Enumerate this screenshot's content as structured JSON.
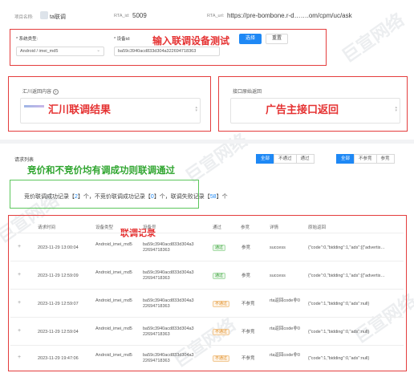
{
  "header": {
    "project_label": "项目名称:",
    "project_name": "ta联调",
    "rta_label": "RTA_id:",
    "rta_id": "5009",
    "url_label": "RTA_url:",
    "url": "https://pre-bombone.r-d…….om/cpm/uc/ask"
  },
  "config": {
    "system_type_label": "* 系统类型:",
    "system_type_value": "Android / imei_md5",
    "device_id_label": "* 设备id:",
    "device_id_value": "ba59c3940acd833d304a322694718363",
    "select_button": "选择",
    "reset_button": "重置"
  },
  "result_panel": {
    "title": "汇川返回内容",
    "help_icon": "?"
  },
  "api_panel": {
    "title": "接口原始返回"
  },
  "list": {
    "title": "请求列表",
    "filter_group_1": [
      "全部",
      "不通过",
      "通过"
    ],
    "filter_group_2": [
      "全部",
      "不参竞",
      "参竞"
    ],
    "summary": {
      "p1": "竞价联调成功记录【",
      "count1": "2",
      "p2": "】个，不竞价联调成功记录【",
      "count2": "0",
      "p3": "】个，联调失败记录【",
      "count3": "58",
      "p4": "】个"
    },
    "columns": [
      "请求时间",
      "设备类型",
      "设备号",
      "通过",
      "参竞",
      "详情",
      "原始返回"
    ],
    "rows": [
      {
        "time": "2023-11-29 13:00:04",
        "device_type": "Android_imei_md5",
        "device_id": "ba59c3940acd833d304a322694718363",
        "pass": "通过",
        "bid": "参竞",
        "detail": "success",
        "raw": "{\"code\":0,\"bidding\":1,\"ads\":[{\"advertis…"
      },
      {
        "time": "2023-11-29 12:59:09",
        "device_type": "Android_imei_md5",
        "device_id": "ba59c3940acd833d304a322694718363",
        "pass": "通过",
        "bid": "参竞",
        "detail": "success",
        "raw": "{\"code\":0,\"bidding\":1,\"ads\":[{\"advertis…"
      },
      {
        "time": "2023-11-29 12:59:07",
        "device_type": "Android_imei_md5",
        "device_id": "ba59c3940acd833d304a322694718363",
        "pass": "不通过",
        "bid": "不参竞",
        "detail": "rta返回code非0",
        "raw": "{\"code\":1,\"bidding\":0,\"ads\":null}"
      },
      {
        "time": "2023-11-29 12:59:04",
        "device_type": "Android_imei_md5",
        "device_id": "ba59c3940acd833d304a322694718363",
        "pass": "不通过",
        "bid": "不参竞",
        "detail": "rta返回code非0",
        "raw": "{\"code\":1,\"bidding\":0,\"ads\":null}"
      },
      {
        "time": "2023-11-29 19:47:06",
        "device_type": "Android_imei_md5",
        "device_id": "ba59c3940acd833d304a322694718363",
        "pass": "不通过",
        "bid": "不参竞",
        "detail": "rta返回code非0",
        "raw": "{\"code\":1,\"bidding\":0,\"ads\":null}"
      }
    ]
  },
  "annotations": {
    "a1": "输入联调设备测试",
    "a2": "汇川联调结果",
    "a3": "广告主接口返回",
    "a4": "竞价和不竞价均有调成功则联调通过",
    "a5": "联调记录"
  },
  "watermarks": [
    "巨宣网络",
    "巨宣网络",
    "巨宣网络",
    "巨宣网络",
    "巨宣网络"
  ],
  "colors": {
    "primary": "#1e88f5",
    "annotation_red": "#e53232",
    "annotation_green": "#2fa52f",
    "success": "#2e9b2e",
    "fail": "#e53232"
  }
}
